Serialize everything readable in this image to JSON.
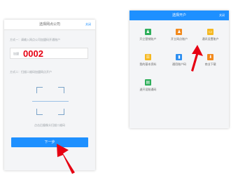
{
  "left_screen": {
    "header_title": "选择网点公司",
    "header_link": "关闭",
    "method1_text": "方式一：请输入网点公司加盟码开通账户",
    "code_label": "加盟",
    "code_value": "0002",
    "method2_text": "方式二：扫描二维码加盟网点开户",
    "scan_hint": "点击后摄像头扫描二维码",
    "next_button": "下一步"
  },
  "right_screen": {
    "header_title": "选择开户",
    "header_link": "关闭",
    "tiles": [
      {
        "label": "开立营销账户",
        "color": "#2eae5a",
        "icon": "person-icon",
        "glyph": "♟"
      },
      {
        "label": "开立网点账户",
        "color": "#f28a1e",
        "icon": "person-icon",
        "glyph": "♟"
      },
      {
        "label": "通讯设置账户",
        "color": "#f5b820",
        "icon": "card-icon",
        "glyph": "▭"
      },
      {
        "label": "我的基本资料",
        "color": "#f5b820",
        "icon": "profile-icon",
        "glyph": "☰"
      },
      {
        "label": "通用账户码",
        "color": "#2e8ff0",
        "icon": "phone-icon",
        "glyph": "▮"
      },
      {
        "label": "商业下载",
        "color": "#f28a1e",
        "icon": "download-icon",
        "glyph": "⬇"
      },
      {
        "label": "退开设账通码",
        "color": "#2eae5a",
        "icon": "document-icon",
        "glyph": "▤"
      }
    ]
  },
  "colors": {
    "accent": "#1e90ff",
    "code": "#e60012",
    "arrow": "#e60012"
  }
}
